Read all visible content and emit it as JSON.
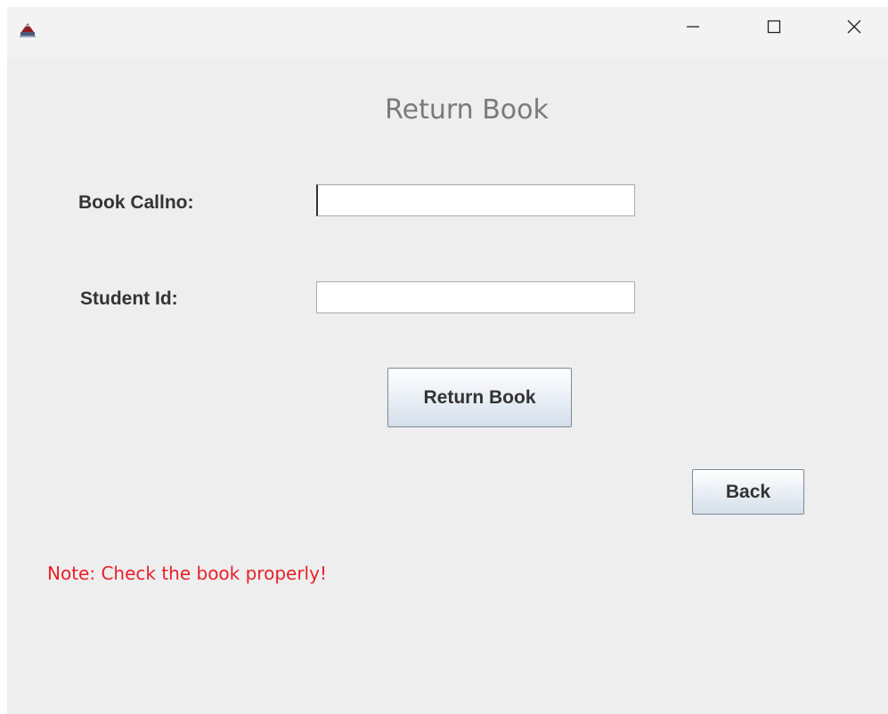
{
  "window": {
    "title": "",
    "icon": "java-coffee-cup-icon",
    "controls": {
      "minimize": "minimize-icon",
      "maximize": "maximize-icon",
      "close": "close-icon"
    }
  },
  "form": {
    "heading": "Return Book",
    "fields": {
      "callno_label": "Book Callno:",
      "callno_value": "",
      "student_label": "Student Id:",
      "student_value": ""
    },
    "buttons": {
      "return_label": "Return Book",
      "back_label": "Back"
    },
    "note": "Note: Check the book properly!"
  },
  "colors": {
    "background": "#eeeeee",
    "heading": "#7a7a7a",
    "note": "#e8202a"
  }
}
